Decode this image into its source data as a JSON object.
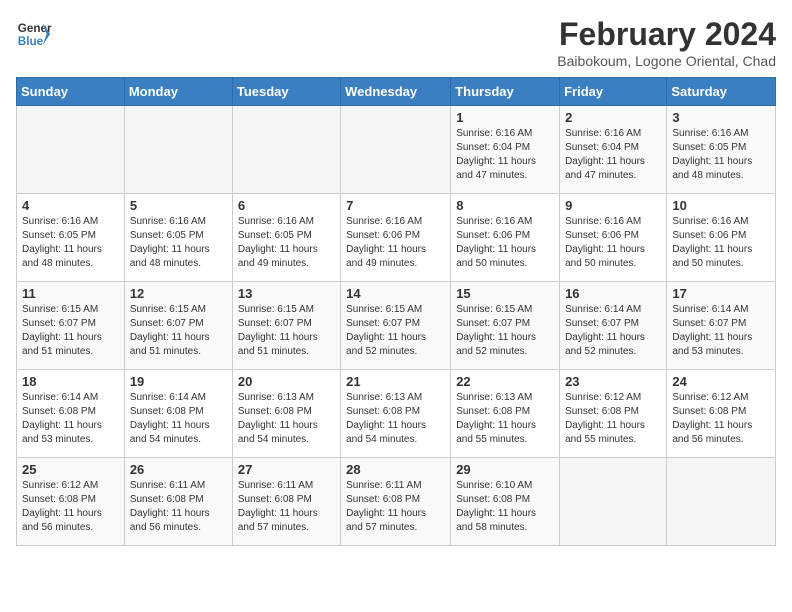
{
  "logo": {
    "line1": "General",
    "line2": "Blue"
  },
  "title": "February 2024",
  "subtitle": "Baibokoum, Logone Oriental, Chad",
  "days_of_week": [
    "Sunday",
    "Monday",
    "Tuesday",
    "Wednesday",
    "Thursday",
    "Friday",
    "Saturday"
  ],
  "weeks": [
    [
      {
        "day": "",
        "info": ""
      },
      {
        "day": "",
        "info": ""
      },
      {
        "day": "",
        "info": ""
      },
      {
        "day": "",
        "info": ""
      },
      {
        "day": "1",
        "info": "Sunrise: 6:16 AM\nSunset: 6:04 PM\nDaylight: 11 hours\nand 47 minutes."
      },
      {
        "day": "2",
        "info": "Sunrise: 6:16 AM\nSunset: 6:04 PM\nDaylight: 11 hours\nand 47 minutes."
      },
      {
        "day": "3",
        "info": "Sunrise: 6:16 AM\nSunset: 6:05 PM\nDaylight: 11 hours\nand 48 minutes."
      }
    ],
    [
      {
        "day": "4",
        "info": "Sunrise: 6:16 AM\nSunset: 6:05 PM\nDaylight: 11 hours\nand 48 minutes."
      },
      {
        "day": "5",
        "info": "Sunrise: 6:16 AM\nSunset: 6:05 PM\nDaylight: 11 hours\nand 48 minutes."
      },
      {
        "day": "6",
        "info": "Sunrise: 6:16 AM\nSunset: 6:05 PM\nDaylight: 11 hours\nand 49 minutes."
      },
      {
        "day": "7",
        "info": "Sunrise: 6:16 AM\nSunset: 6:06 PM\nDaylight: 11 hours\nand 49 minutes."
      },
      {
        "day": "8",
        "info": "Sunrise: 6:16 AM\nSunset: 6:06 PM\nDaylight: 11 hours\nand 50 minutes."
      },
      {
        "day": "9",
        "info": "Sunrise: 6:16 AM\nSunset: 6:06 PM\nDaylight: 11 hours\nand 50 minutes."
      },
      {
        "day": "10",
        "info": "Sunrise: 6:16 AM\nSunset: 6:06 PM\nDaylight: 11 hours\nand 50 minutes."
      }
    ],
    [
      {
        "day": "11",
        "info": "Sunrise: 6:15 AM\nSunset: 6:07 PM\nDaylight: 11 hours\nand 51 minutes."
      },
      {
        "day": "12",
        "info": "Sunrise: 6:15 AM\nSunset: 6:07 PM\nDaylight: 11 hours\nand 51 minutes."
      },
      {
        "day": "13",
        "info": "Sunrise: 6:15 AM\nSunset: 6:07 PM\nDaylight: 11 hours\nand 51 minutes."
      },
      {
        "day": "14",
        "info": "Sunrise: 6:15 AM\nSunset: 6:07 PM\nDaylight: 11 hours\nand 52 minutes."
      },
      {
        "day": "15",
        "info": "Sunrise: 6:15 AM\nSunset: 6:07 PM\nDaylight: 11 hours\nand 52 minutes."
      },
      {
        "day": "16",
        "info": "Sunrise: 6:14 AM\nSunset: 6:07 PM\nDaylight: 11 hours\nand 52 minutes."
      },
      {
        "day": "17",
        "info": "Sunrise: 6:14 AM\nSunset: 6:07 PM\nDaylight: 11 hours\nand 53 minutes."
      }
    ],
    [
      {
        "day": "18",
        "info": "Sunrise: 6:14 AM\nSunset: 6:08 PM\nDaylight: 11 hours\nand 53 minutes."
      },
      {
        "day": "19",
        "info": "Sunrise: 6:14 AM\nSunset: 6:08 PM\nDaylight: 11 hours\nand 54 minutes."
      },
      {
        "day": "20",
        "info": "Sunrise: 6:13 AM\nSunset: 6:08 PM\nDaylight: 11 hours\nand 54 minutes."
      },
      {
        "day": "21",
        "info": "Sunrise: 6:13 AM\nSunset: 6:08 PM\nDaylight: 11 hours\nand 54 minutes."
      },
      {
        "day": "22",
        "info": "Sunrise: 6:13 AM\nSunset: 6:08 PM\nDaylight: 11 hours\nand 55 minutes."
      },
      {
        "day": "23",
        "info": "Sunrise: 6:12 AM\nSunset: 6:08 PM\nDaylight: 11 hours\nand 55 minutes."
      },
      {
        "day": "24",
        "info": "Sunrise: 6:12 AM\nSunset: 6:08 PM\nDaylight: 11 hours\nand 56 minutes."
      }
    ],
    [
      {
        "day": "25",
        "info": "Sunrise: 6:12 AM\nSunset: 6:08 PM\nDaylight: 11 hours\nand 56 minutes."
      },
      {
        "day": "26",
        "info": "Sunrise: 6:11 AM\nSunset: 6:08 PM\nDaylight: 11 hours\nand 56 minutes."
      },
      {
        "day": "27",
        "info": "Sunrise: 6:11 AM\nSunset: 6:08 PM\nDaylight: 11 hours\nand 57 minutes."
      },
      {
        "day": "28",
        "info": "Sunrise: 6:11 AM\nSunset: 6:08 PM\nDaylight: 11 hours\nand 57 minutes."
      },
      {
        "day": "29",
        "info": "Sunrise: 6:10 AM\nSunset: 6:08 PM\nDaylight: 11 hours\nand 58 minutes."
      },
      {
        "day": "",
        "info": ""
      },
      {
        "day": "",
        "info": ""
      }
    ]
  ]
}
